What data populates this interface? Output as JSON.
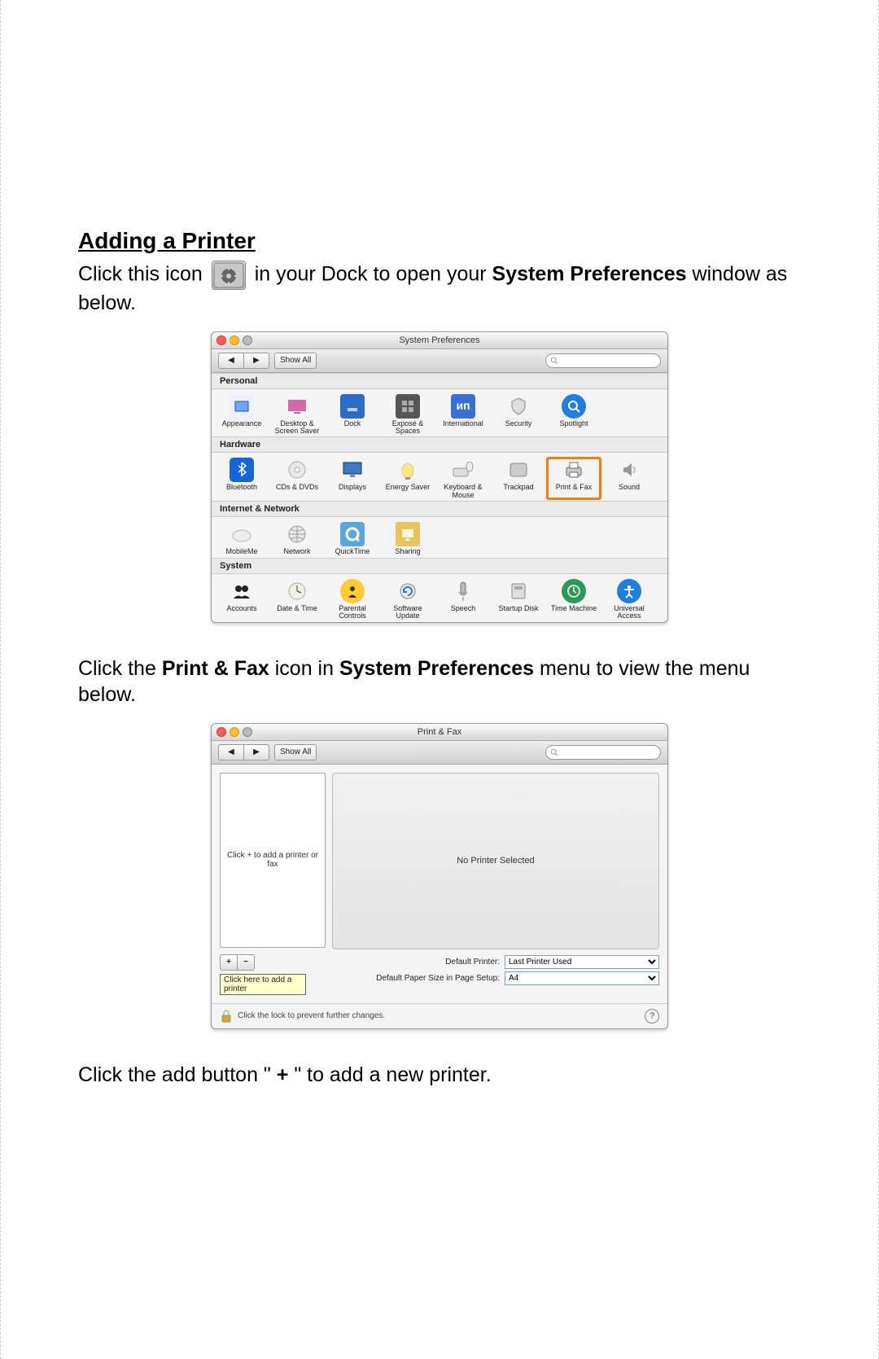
{
  "doc": {
    "heading": "Adding a Printer",
    "p1_a": "Click this icon ",
    "p1_b": " in your Dock to open your ",
    "p1_bold": "System Preferences",
    "p1_c": " window as below.",
    "p2_a": "Click the ",
    "p2_bold1": "Print & Fax",
    "p2_b": " icon in ",
    "p2_bold2": "System Preferences",
    "p2_c": " menu to view the menu below.",
    "p3_a": "Click the add button \"",
    "p3_bold": "+",
    "p3_b": "\" to add a new printer."
  },
  "sysprefs": {
    "title": "System Preferences",
    "show_all": "Show All",
    "sections": {
      "personal": "Personal",
      "hardware": "Hardware",
      "internet": "Internet & Network",
      "system": "System"
    },
    "items": {
      "appearance": "Appearance",
      "desktop": "Desktop & Screen Saver",
      "dock": "Dock",
      "expose": "Exposé & Spaces",
      "international": "International",
      "security": "Security",
      "spotlight": "Spotlight",
      "bluetooth": "Bluetooth",
      "cds": "CDs & DVDs",
      "displays": "Displays",
      "energy": "Energy Saver",
      "keyboard": "Keyboard & Mouse",
      "trackpad": "Trackpad",
      "printfax": "Print & Fax",
      "sound": "Sound",
      "mobileme": "MobileMe",
      "network": "Network",
      "quicktime": "QuickTime",
      "sharing": "Sharing",
      "accounts": "Accounts",
      "datetime": "Date & Time",
      "parental": "Parental Controls",
      "software": "Software Update",
      "speech": "Speech",
      "startup": "Startup Disk",
      "timemachine": "Time Machine",
      "universal": "Universal Access"
    }
  },
  "printfax": {
    "title": "Print & Fax",
    "show_all": "Show All",
    "empty_list": "Click + to add a printer or fax",
    "no_printer": "No Printer Selected",
    "add": "+",
    "remove": "−",
    "tooltip": "Click here to add a printer",
    "default_printer_label": "Default Printer:",
    "default_printer_value": "Last Printer Used",
    "paper_label": "Default Paper Size in Page Setup:",
    "paper_value": "A4",
    "lock_text": "Click the lock to prevent further changes.",
    "help": "?"
  }
}
